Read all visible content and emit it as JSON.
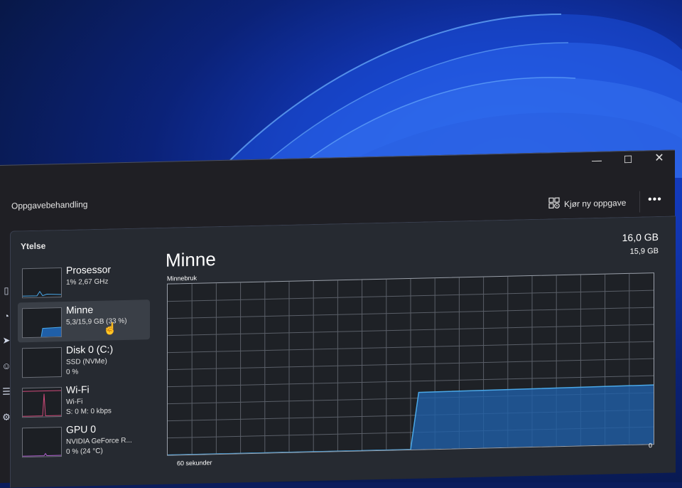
{
  "window": {
    "title": "Oppgavebehandling",
    "controls": {
      "minimize": "—",
      "maximize": "☐",
      "close": "✕"
    }
  },
  "toolbar": {
    "run_new_task_label": "Kjør ny oppgave",
    "more_label": "•••"
  },
  "section": {
    "title": "Ytelse"
  },
  "sidebar": [
    {
      "name": "Prosessor",
      "line1": "1% 2,67 GHz",
      "line2": "",
      "active": false
    },
    {
      "name": "Minne",
      "line1": "5,3/15,9 GB (33 %)",
      "line2": "",
      "active": true
    },
    {
      "name": "Disk 0 (C:)",
      "line1": "SSD (NVMe)",
      "line2": "0 %",
      "active": false
    },
    {
      "name": "Wi-Fi",
      "line1": "Wi-Fi",
      "line2": "S: 0 M: 0 kbps",
      "active": false
    },
    {
      "name": "GPU 0",
      "line1": "NVIDIA GeForce R...",
      "line2": "0 % (24 °C)",
      "active": false
    }
  ],
  "detail": {
    "title": "Minne",
    "total": "16,0 GB",
    "graph_max": "15,9 GB",
    "graph_label": "Minnebruk",
    "time_span_label": "60 sekunder",
    "min_label": "0"
  },
  "chart_data": {
    "type": "area",
    "title": "Minnebruk",
    "xlabel": "60 sekunder",
    "ylabel": "",
    "ylim": [
      0,
      15.9
    ],
    "x": [
      60,
      30,
      29,
      0
    ],
    "values": [
      0,
      0,
      5.3,
      5.5
    ],
    "grid": true,
    "fill_color": "#1f5fa8",
    "line_color": "#4aa8e8"
  },
  "colors": {
    "accent": "#4aa8e8",
    "window_bg": "#1f1f24",
    "active_item": "#3a3f47"
  },
  "icons": {
    "run_task": "run-task-icon",
    "cursor": "cursor-hand-icon"
  }
}
